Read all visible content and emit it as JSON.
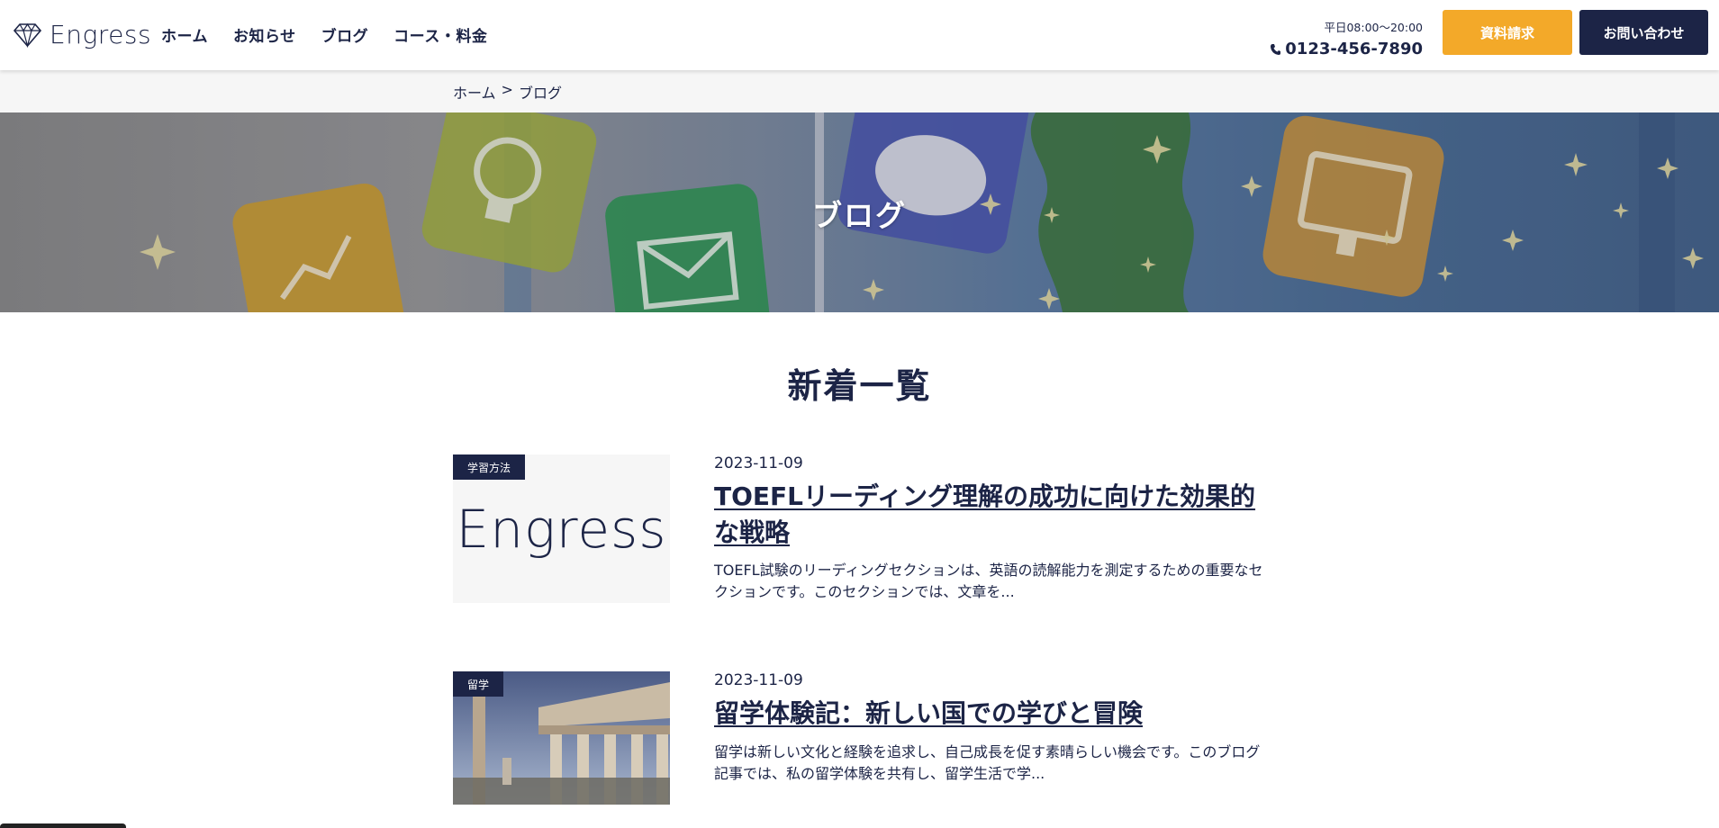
{
  "header": {
    "logo_text": "Engress",
    "nav": [
      "ホーム",
      "お知らせ",
      "ブログ",
      "コース・料金"
    ],
    "hours": "平日08:00〜20:00",
    "phone": "0123-456-7890",
    "request_button": "資料請求",
    "contact_button": "お問い合わせ"
  },
  "breadcrumb": {
    "home": "ホーム",
    "separator": ">",
    "current": "ブログ"
  },
  "hero": {
    "title": "ブログ"
  },
  "section": {
    "title": "新着一覧"
  },
  "posts": [
    {
      "category": "学習方法",
      "date": "2023-11-09",
      "title": "TOEFLリーディング理解の成功に向けた効果的な戦略",
      "excerpt": "TOEFL試験のリーディングセクションは、英語の読解能力を測定するための重要なセクションです。このセクションでは、文章を...",
      "thumb_text": "Engress"
    },
    {
      "category": "留学",
      "date": "2023-11-09",
      "title": "留学体験記：新しい国での学びと冒険",
      "excerpt": "留学は新しい文化と経験を追求し、自己成長を促す素晴らしい機会です。このブログ記事では、私の留学体験を共有し、留学生活で学..."
    }
  ],
  "colors": {
    "navy": "#1c2446",
    "orange": "#f3a929"
  }
}
